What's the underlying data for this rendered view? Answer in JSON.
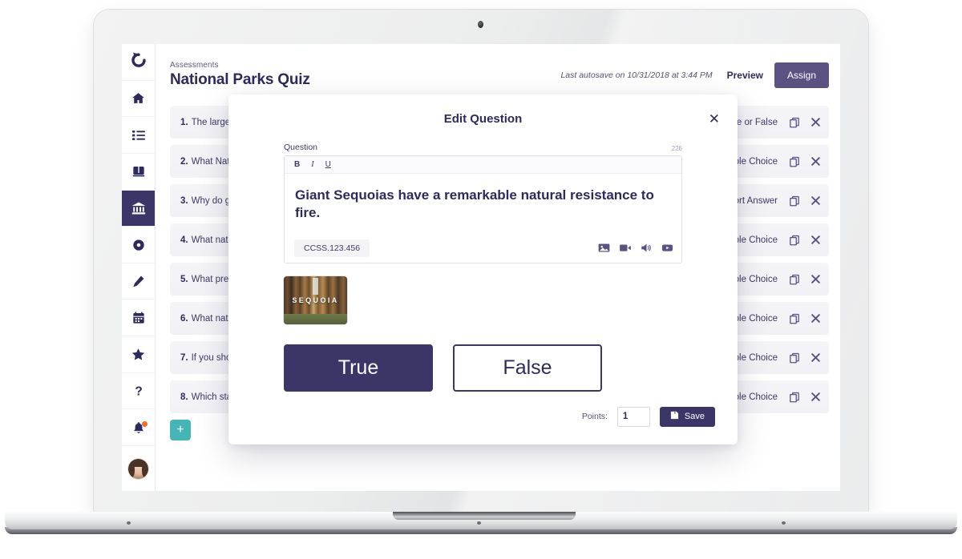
{
  "app": {
    "logo_icon": "circular-arrow-logo",
    "breadcrumb": "Assessments",
    "title": "National Parks Quiz",
    "autosave": "Last autosave on 10/31/2018 at 3:44 PM",
    "preview_label": "Preview",
    "assign_label": "Assign",
    "add_question_label": "+"
  },
  "colors": {
    "navy": "#2e2a5d",
    "navy_dark": "#3b3568",
    "purple": "#5b5282",
    "teal": "#46b5b8",
    "notification_orange": "#f56a28",
    "row_gray": "#f5f5f8"
  },
  "sidebar": {
    "items": [
      {
        "icon": "home-icon",
        "name": "home",
        "active": false
      },
      {
        "icon": "list-icon",
        "name": "classes",
        "active": false
      },
      {
        "icon": "book-icon",
        "name": "library",
        "active": false
      },
      {
        "icon": "bank-icon",
        "name": "assessments",
        "active": true
      },
      {
        "icon": "record-icon",
        "name": "reports",
        "active": false
      },
      {
        "icon": "pencil-icon",
        "name": "grading",
        "active": false
      },
      {
        "icon": "calendar-icon",
        "name": "calendar",
        "active": false
      },
      {
        "icon": "star-icon",
        "name": "favorites",
        "active": false
      },
      {
        "icon": "question-mark-icon",
        "name": "help",
        "active": false
      },
      {
        "icon": "bell-icon",
        "name": "notifications",
        "active": false,
        "badge": true
      }
    ],
    "avatar_icon": "user-avatar"
  },
  "questions": [
    {
      "num": "1.",
      "text": "The largest",
      "type": "True or False"
    },
    {
      "num": "2.",
      "text": "What Natio",
      "type": "Multiple Choice"
    },
    {
      "num": "3.",
      "text": "Why do gia",
      "type": "Short Answer"
    },
    {
      "num": "4.",
      "text": "What natio",
      "type": "Multiple Choice"
    },
    {
      "num": "5.",
      "text": "What presi",
      "type": "Multiple Choice"
    },
    {
      "num": "6.",
      "text": "What natio",
      "type": "Multiple Choice"
    },
    {
      "num": "7.",
      "text": "If you shot",
      "type": "Multiple Choice"
    },
    {
      "num": "8.",
      "text": "Which stat",
      "type": "Multiple Choice"
    }
  ],
  "modal": {
    "title": "Edit Question",
    "close_icon": "close-icon",
    "question_label": "Question",
    "char_count": "226",
    "toolbar": {
      "bold": "B",
      "italic": "I",
      "underline": "U"
    },
    "question_text": "Giant Sequoias have a remarkable natural resistance to fire.",
    "standard_tag": "CCSS.123.456",
    "media_icons": [
      "image-icon",
      "video-icon",
      "audio-icon",
      "youtube-icon"
    ],
    "attachment": {
      "label": "SEQUOIA",
      "alt": "sequoia-forest-thumbnail"
    },
    "choices": [
      {
        "label": "True",
        "selected": true
      },
      {
        "label": "False",
        "selected": false
      }
    ],
    "points_label": "Points:",
    "points_value": "1",
    "save_label": "Save",
    "save_icon": "save-icon"
  }
}
